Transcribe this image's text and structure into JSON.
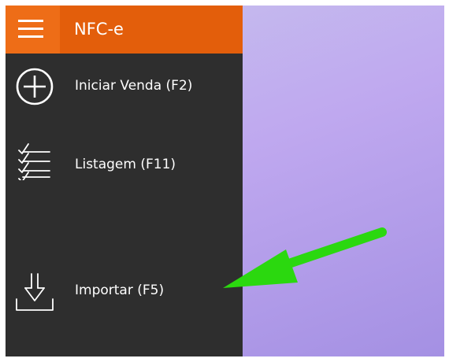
{
  "app": {
    "title": "NFC-e"
  },
  "menu": {
    "items": [
      {
        "label": "Iniciar Venda (F2)",
        "icon": "plus-circle-icon"
      },
      {
        "label": "Listagem (F11)",
        "icon": "checklist-icon"
      },
      {
        "label": "Importar (F5)",
        "icon": "import-download-icon"
      }
    ]
  },
  "overlay": {
    "annotation_icon": "green-arrow-icon"
  },
  "colors": {
    "header_orange": "#e35e0b",
    "hamburger_orange": "#ee6d17",
    "sidebar_bg": "#2e2e2e",
    "text": "#ffffff",
    "annotation_green": "#2bd80f",
    "background_gradient_start": "#c7c2ee",
    "background_gradient_end": "#a490e3"
  }
}
